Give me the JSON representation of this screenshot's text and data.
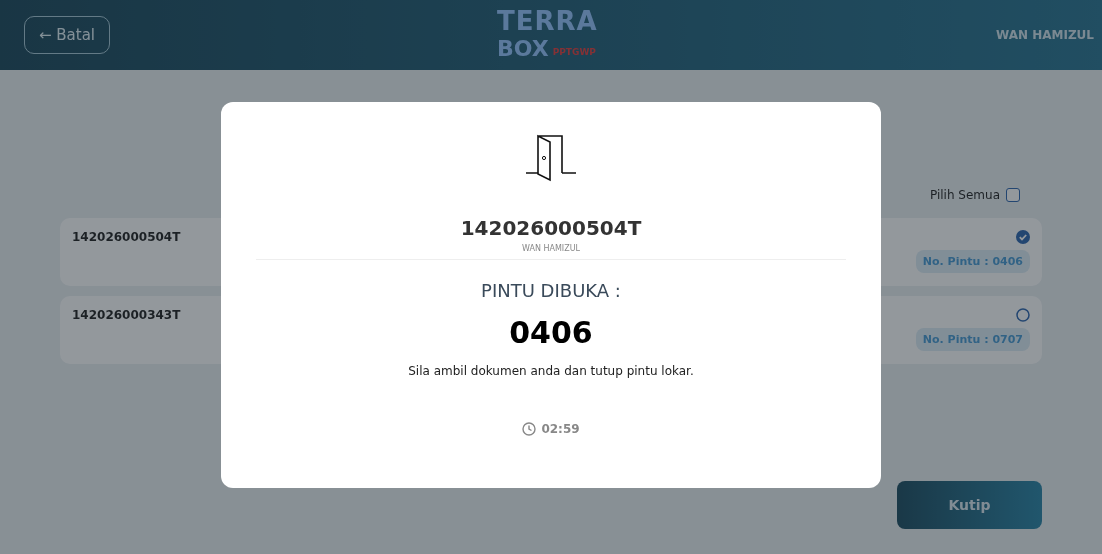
{
  "header": {
    "back_button": "← Batal",
    "logo": {
      "top": "TERRA",
      "bottom": "BOX",
      "tag": "PPTGWP"
    },
    "user": "WAN HAMIZUL"
  },
  "select_all": {
    "label": "Pilih Semua",
    "checked": false
  },
  "items": [
    {
      "id": "142026000504T",
      "selected": true,
      "door": "No. Pintu : 0406"
    },
    {
      "id": "142026000343T",
      "selected": false,
      "door": "No. Pintu : 0707"
    }
  ],
  "collect_button": "Kutip",
  "dialog": {
    "id": "142026000504T",
    "owner": "WAN HAMIZUL",
    "heading": "PINTU DIBUKA :",
    "door_number": "0406",
    "message": "Sila ambil dokumen anda dan tutup pintu lokar.",
    "timer": "02:59"
  }
}
